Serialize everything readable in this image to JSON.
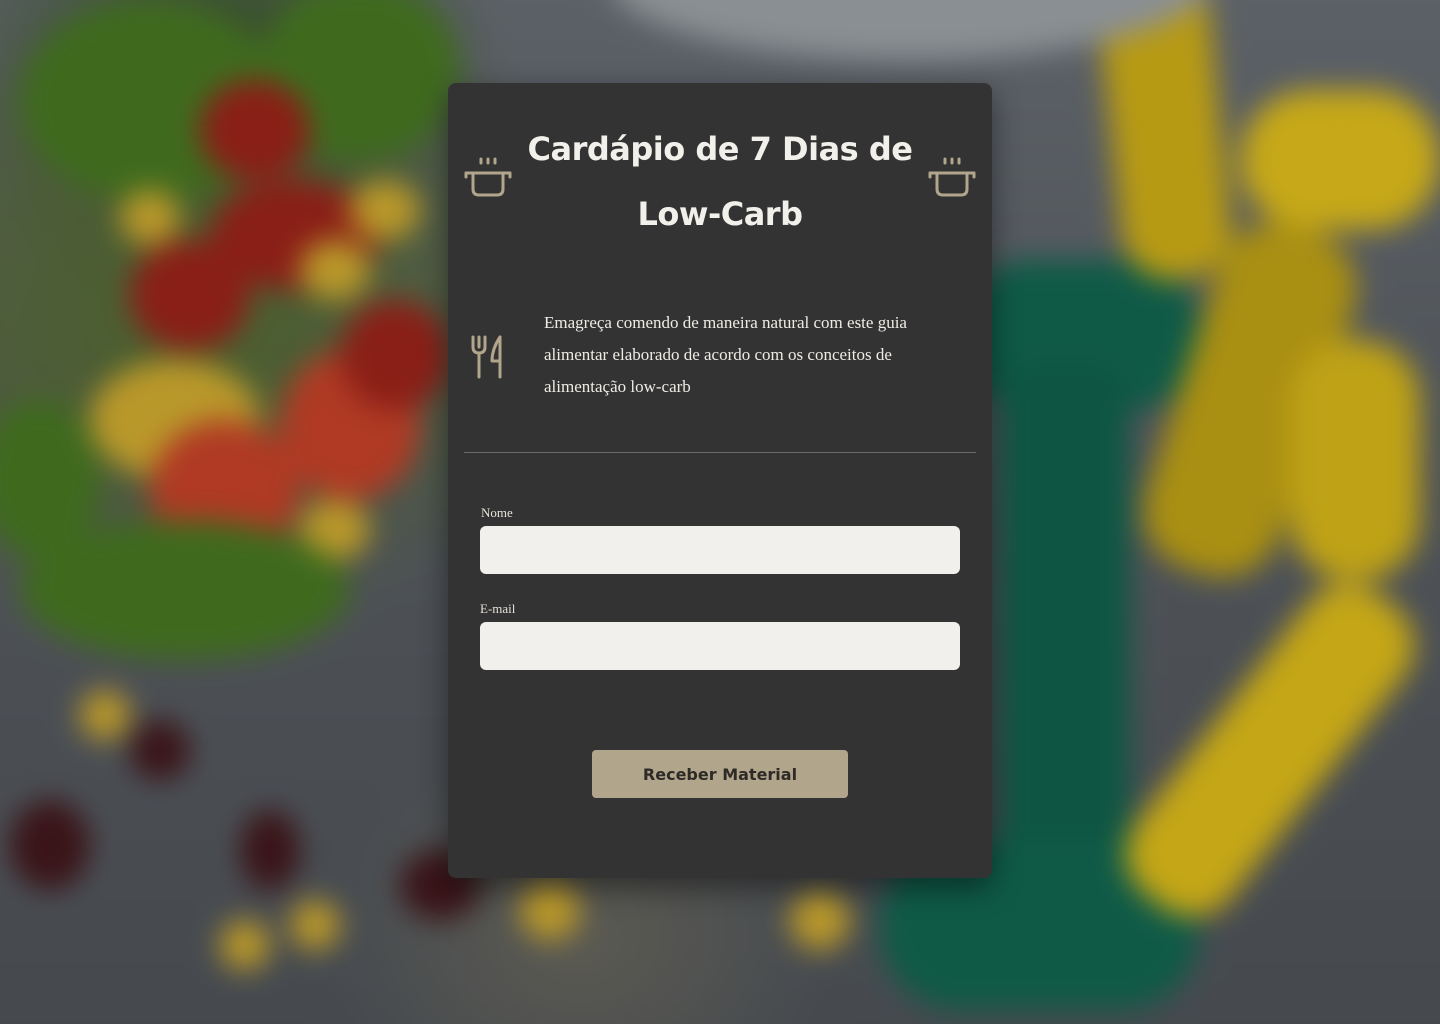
{
  "card": {
    "title": "Cardápio de 7 Dias de Low-Carb",
    "description": "Emagreça comendo de maneira natural com este guia alimentar elaborado de acordo com os conceitos de alimentação low-carb",
    "icons": {
      "left_header": "cooking-pot-icon",
      "right_header": "cooking-pot-icon",
      "description": "fork-knife-icon"
    }
  },
  "form": {
    "name_label": "Nome",
    "name_value": "",
    "email_label": "E-mail",
    "email_value": "",
    "submit_label": "Receber Material"
  },
  "colors": {
    "card_background": "#333333",
    "accent": "#b1a58c",
    "input_background": "#f2f0ec",
    "text_light": "#f2f0ea"
  }
}
